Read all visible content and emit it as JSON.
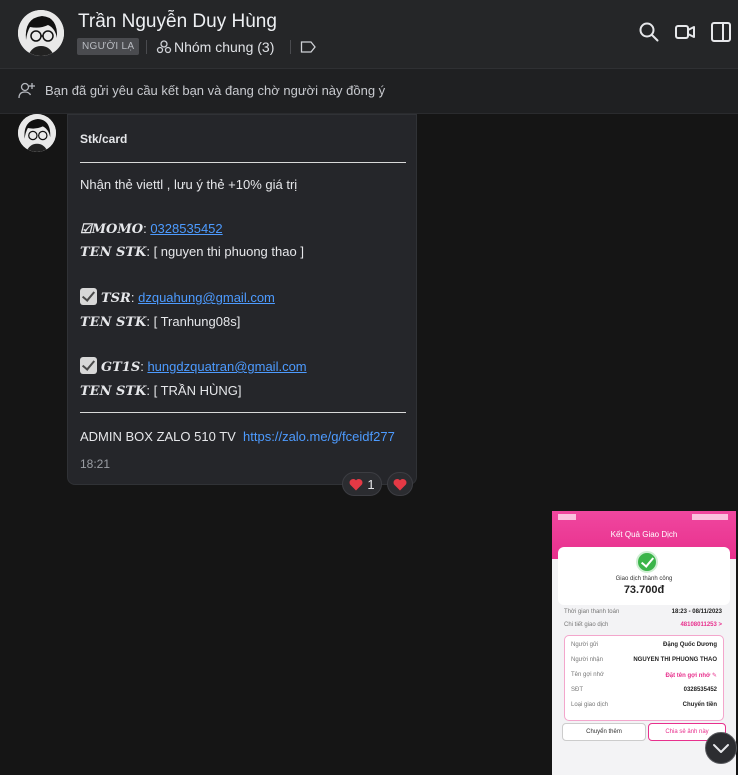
{
  "header": {
    "name": "Trần Nguyễn Duy Hùng",
    "stranger_badge": "NGƯỜI LẠ",
    "group_label": "Nhóm chung (3)"
  },
  "info_bar": {
    "text": "Bạn đã gửi yêu cầu kết bạn và đang chờ người này đồng ý"
  },
  "message": {
    "title": "Stk/card",
    "line1": "Nhận thẻ viettl , lưu ý thẻ +10% giá trị",
    "momo_label": "☑MOMO",
    "momo_value": "0328535452",
    "ten_stk_label": "TEN STK",
    "ten_stk_1": ": [ nguyen thi phuong thao ]",
    "tsr_label": "TSR",
    "tsr_value": "dzquahung@gmail.com",
    "ten_stk_2": ": [ Tranhung08s]",
    "gt1s_label": "GT1S",
    "gt1s_value": "hungdzquatran@gmail.com",
    "ten_stk_3": ": [ TRẦN HÙNG]",
    "admin_text": "ADMIN BOX ZALO 510 TV",
    "admin_link": "https://zalo.me/g/fceidf277",
    "time": "18:21",
    "reaction_count": "1"
  },
  "image": {
    "title": "Kết Quả Giao Dịch",
    "status": "Giao dịch thành công",
    "amount": "73.700đ",
    "rows": [
      {
        "label": "Thời gian thanh toán",
        "value": "18:23 - 08/11/2023"
      },
      {
        "label": "Chi tiết giao dịch",
        "value": "48108011253 >"
      }
    ],
    "details": [
      {
        "label": "Người gửi",
        "value": "Đặng Quốc Dương"
      },
      {
        "label": "Người nhận",
        "value": "NGUYEN THI PHUONG THAO"
      },
      {
        "label": "Tên gợi nhớ",
        "value": "Đặt tên gợi nhớ ✎"
      },
      {
        "label": "SĐT",
        "value": "0328535452"
      },
      {
        "label": "Loại giao dịch",
        "value": "Chuyển tiền"
      }
    ],
    "btn_more": "Chuyển thêm",
    "btn_share": "Chia sẻ ảnh này"
  },
  "colors": {
    "accent_link": "#4d9bff",
    "heart": "#e53945",
    "pink": "#e8308d"
  },
  "icons": [
    "search-icon",
    "video-call-icon",
    "sidebar-toggle-icon",
    "add-friend-icon",
    "chevron-down-icon",
    "heart-icon"
  ]
}
